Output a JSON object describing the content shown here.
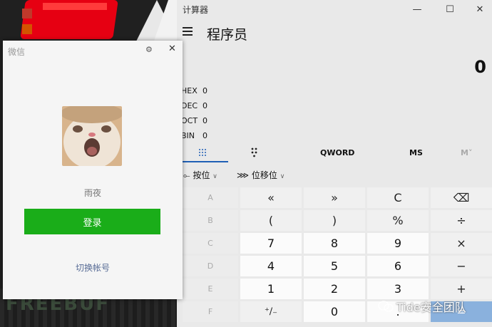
{
  "desktop": {
    "watermark": "FREEBUF"
  },
  "calculator": {
    "window_title": "计算器",
    "mode": "程序员",
    "display": "0",
    "radix": [
      {
        "name": "HEX",
        "value": "0"
      },
      {
        "name": "DEC",
        "value": "0"
      },
      {
        "name": "OCT",
        "value": "0"
      },
      {
        "name": "BIN",
        "value": "0"
      }
    ],
    "tabs": {
      "word": "QWORD",
      "ms": "MS",
      "mv": "M˅"
    },
    "bitwise": "按位",
    "bitshift": "位移位",
    "keys": [
      [
        "A",
        "«",
        "»",
        "C",
        "⌫"
      ],
      [
        "B",
        "(",
        ")",
        "%",
        "÷"
      ],
      [
        "C",
        "7",
        "8",
        "9",
        "×"
      ],
      [
        "D",
        "4",
        "5",
        "6",
        "−"
      ],
      [
        "E",
        "1",
        "2",
        "3",
        "+"
      ],
      [
        "F",
        "⁺∕₋",
        "0",
        ".",
        "="
      ]
    ]
  },
  "wechat": {
    "title": "微信",
    "username": "雨夜",
    "login_button": "登录",
    "switch_account": "切换帐号"
  },
  "watermark": {
    "text": "Tide安全团队"
  }
}
